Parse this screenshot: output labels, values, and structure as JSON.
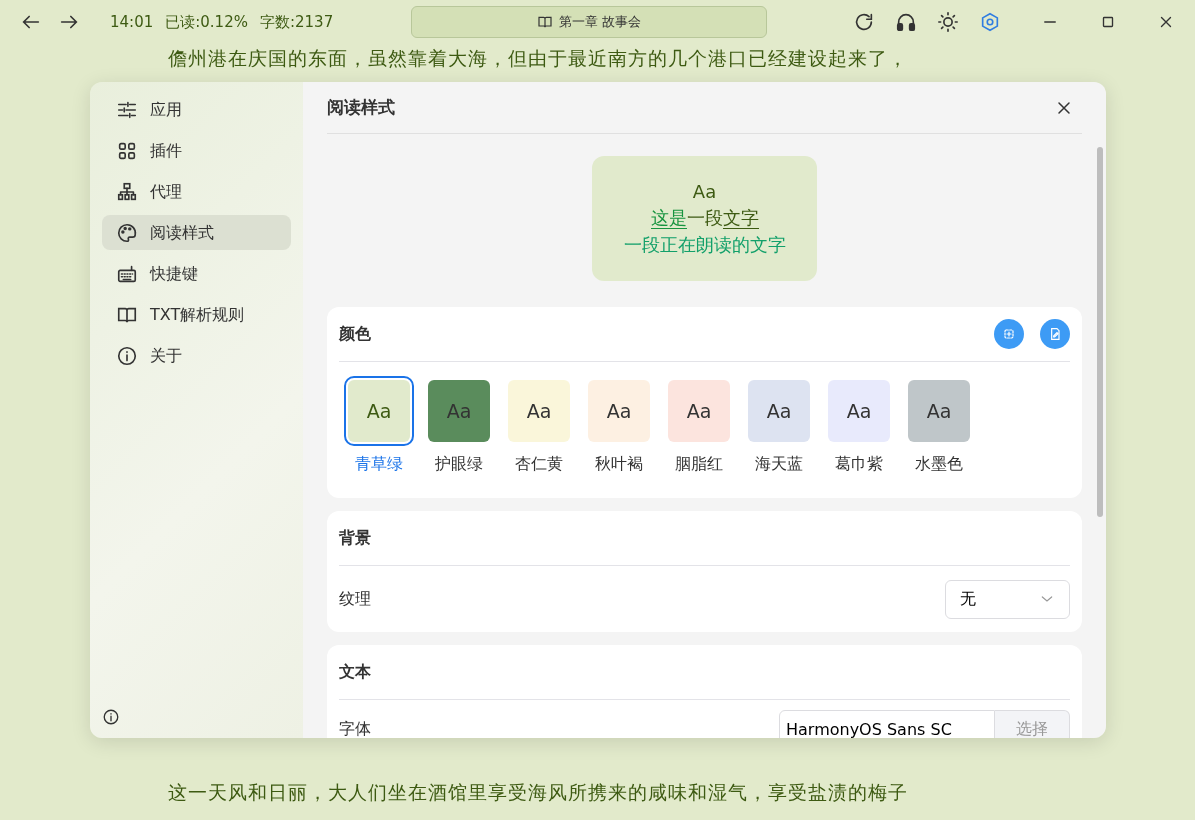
{
  "title_bar": {
    "time": "14:01",
    "progress": "已读:0.12%",
    "word_count": "字数:2137",
    "chapter": "第一章 故事会"
  },
  "reader_lines": [
    "儋州港在庆国的东面，虽然靠着大海，但由于最近南方的几个港口已经建设起来了，",
    "这一天风和日丽，大人们坐在酒馆里享受海风所携来的咸味和湿气，享受盐渍的梅子"
  ],
  "sidebar": {
    "items": [
      {
        "label": "应用",
        "selected": false
      },
      {
        "label": "插件",
        "selected": false
      },
      {
        "label": "代理",
        "selected": false
      },
      {
        "label": "阅读样式",
        "selected": true
      },
      {
        "label": "快捷键",
        "selected": false
      },
      {
        "label": "TXT解析规则",
        "selected": false
      },
      {
        "label": "关于",
        "selected": false
      }
    ]
  },
  "dialog": {
    "title": "阅读样式"
  },
  "preview": {
    "sample": "Aa",
    "segments": [
      {
        "text": "这是",
        "kind": "link"
      },
      {
        "text": "一段",
        "kind": "plain"
      },
      {
        "text": "文字",
        "kind": "underline"
      }
    ],
    "reading_line": "一段正在朗读的文字"
  },
  "color_section": {
    "title": "颜色",
    "themes": [
      {
        "label": "青草绿",
        "sample": "Aa",
        "color": "#e1eacc",
        "selected": true
      },
      {
        "label": "护眼绿",
        "sample": "Aa",
        "color": "#5a8c5c",
        "selected": false
      },
      {
        "label": "杏仁黄",
        "sample": "Aa",
        "color": "#faf6da",
        "selected": false
      },
      {
        "label": "秋叶褐",
        "sample": "Aa",
        "color": "#fdf0e2",
        "selected": false
      },
      {
        "label": "胭脂红",
        "sample": "Aa",
        "color": "#fce4de",
        "selected": false
      },
      {
        "label": "海天蓝",
        "sample": "Aa",
        "color": "#dde3f1",
        "selected": false
      },
      {
        "label": "葛巾紫",
        "sample": "Aa",
        "color": "#e8eafc",
        "selected": false
      },
      {
        "label": "水墨色",
        "sample": "Aa",
        "color": "#bfc6c9",
        "selected": false
      }
    ]
  },
  "background_section": {
    "title": "背景",
    "texture_label": "纹理",
    "texture_value": "无"
  },
  "text_section": {
    "title": "文本",
    "font_label": "字体",
    "font_value": "HarmonyOS Sans SC",
    "font_button": "选择"
  }
}
